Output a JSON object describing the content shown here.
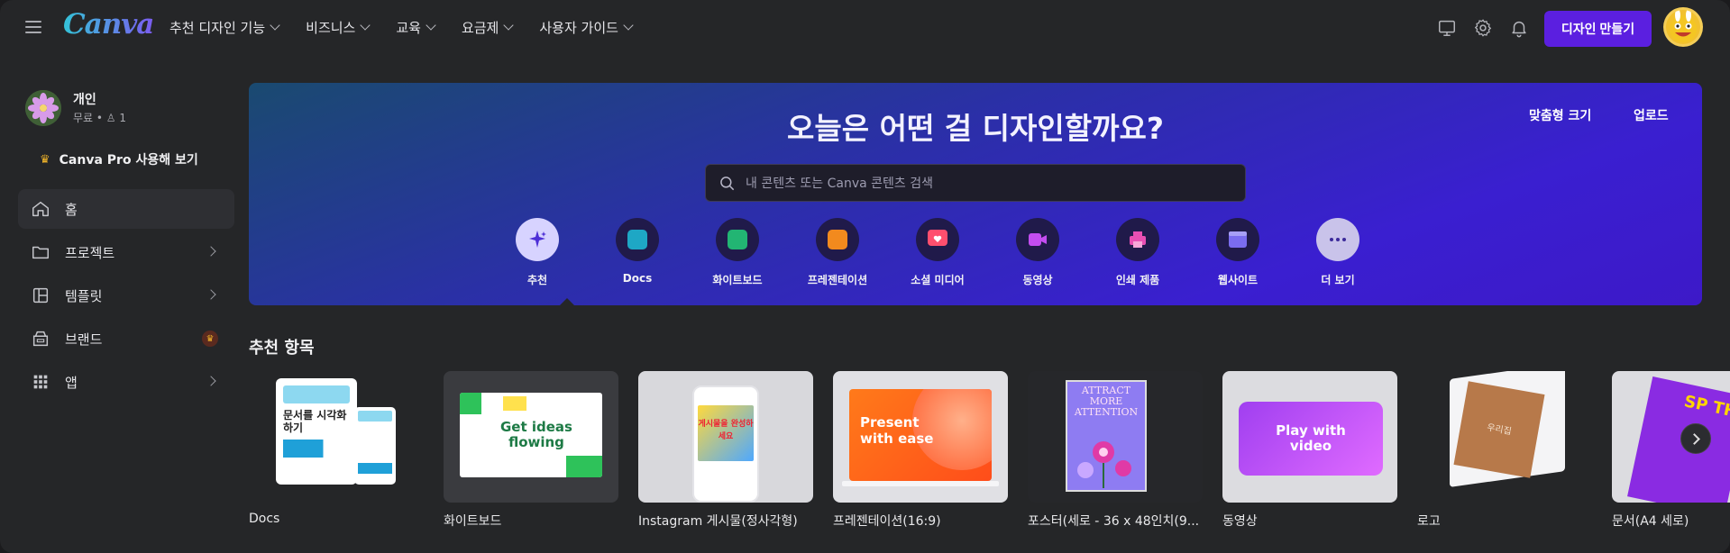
{
  "header": {
    "logo": "Canva",
    "nav": [
      {
        "label": "추천 디자인 기능"
      },
      {
        "label": "비즈니스"
      },
      {
        "label": "교육"
      },
      {
        "label": "요금제"
      },
      {
        "label": "사용자 가이드"
      }
    ],
    "create_button": "디자인 만들기",
    "icons": [
      "monitor-icon",
      "gear-icon",
      "bell-icon"
    ]
  },
  "sidebar": {
    "team_name": "개인",
    "team_plan": "무료 • ♙ 1",
    "pro_label": "Canva Pro 사용해 보기",
    "items": [
      {
        "label": "홈",
        "icon": "home-icon"
      },
      {
        "label": "프로젝트",
        "icon": "folder-icon"
      },
      {
        "label": "템플릿",
        "icon": "template-icon"
      },
      {
        "label": "브랜드",
        "icon": "brand-icon"
      },
      {
        "label": "앱",
        "icon": "apps-icon"
      }
    ]
  },
  "hero": {
    "title": "오늘은 어떤 걸 디자인할까요?",
    "custom_size": "맞춤형 크기",
    "upload": "업로드",
    "search_placeholder": "내 콘텐츠 또는 Canva 콘텐츠 검색",
    "categories": [
      {
        "label": "추천",
        "color": "#6b4ff0"
      },
      {
        "label": "Docs",
        "color": "#1ea7c5"
      },
      {
        "label": "화이트보드",
        "color": "#22b573"
      },
      {
        "label": "프레젠테이션",
        "color": "#f28a1e"
      },
      {
        "label": "소셜 미디어",
        "color": "#ff4f6e"
      },
      {
        "label": "동영상",
        "color": "#c34df0"
      },
      {
        "label": "인쇄 제품",
        "color": "#e84fb3"
      },
      {
        "label": "웹사이트",
        "color": "#7a6cf0"
      },
      {
        "label": "더 보기",
        "color": "#ffffff"
      }
    ]
  },
  "recommended": {
    "title": "추천 항목",
    "items": [
      {
        "label": "Docs",
        "thumb_text": "문서를 시각화하기"
      },
      {
        "label": "화이트보드",
        "thumb_text": "Get ideas flowing"
      },
      {
        "label": "Instagram 게시물(정사각형)",
        "thumb_text": "게시물을 완성하세요"
      },
      {
        "label": "프레젠테이션(16:9)",
        "thumb_text": "Present with ease"
      },
      {
        "label": "포스터(세로 - 36 x 48인치(9...",
        "thumb_text": "ATTRACT MORE ATTENTION"
      },
      {
        "label": "동영상",
        "thumb_text": "Play with video"
      },
      {
        "label": "로고",
        "thumb_text": "우리집"
      },
      {
        "label": "문서(A4 세로)",
        "thumb_text": "SP TH"
      }
    ]
  }
}
